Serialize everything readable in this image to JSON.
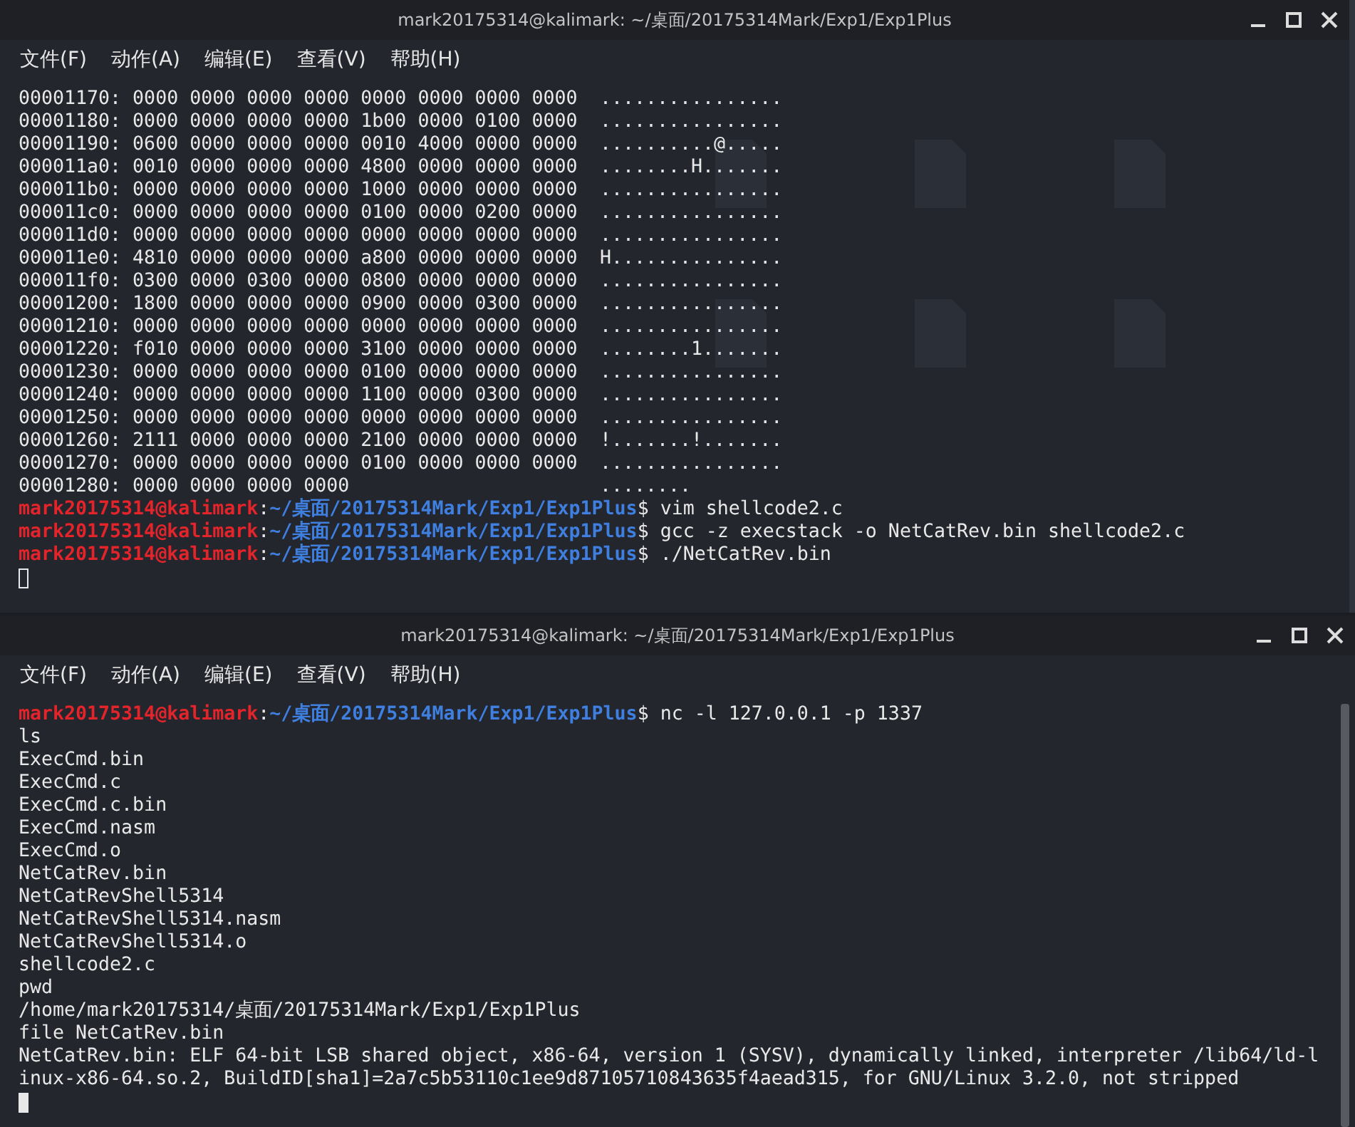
{
  "windows": [
    {
      "title": "mark20175314@kalimark: ~/桌面/20175314Mark/Exp1/Exp1Plus",
      "focused": false,
      "scrollbar": false,
      "desktop_behind": true,
      "menu": [
        "文件(F)",
        "动作(A)",
        "编辑(E)",
        "查看(V)",
        "帮助(H)"
      ],
      "lines": [
        {
          "kind": "hex",
          "text": "00001170: 0000 0000 0000 0000 0000 0000 0000 0000",
          "ascii": "................"
        },
        {
          "kind": "hex",
          "text": "00001180: 0000 0000 0000 0000 1b00 0000 0100 0000",
          "ascii": "................"
        },
        {
          "kind": "hex",
          "text": "00001190: 0600 0000 0000 0000 0010 4000 0000 0000",
          "ascii": "..........@....."
        },
        {
          "kind": "hex",
          "text": "000011a0: 0010 0000 0000 0000 4800 0000 0000 0000",
          "ascii": "........H......."
        },
        {
          "kind": "hex",
          "text": "000011b0: 0000 0000 0000 0000 1000 0000 0000 0000",
          "ascii": "................"
        },
        {
          "kind": "hex",
          "text": "000011c0: 0000 0000 0000 0000 0100 0000 0200 0000",
          "ascii": "................"
        },
        {
          "kind": "hex",
          "text": "000011d0: 0000 0000 0000 0000 0000 0000 0000 0000",
          "ascii": "................"
        },
        {
          "kind": "hex",
          "text": "000011e0: 4810 0000 0000 0000 a800 0000 0000 0000",
          "ascii": "H..............."
        },
        {
          "kind": "hex",
          "text": "000011f0: 0300 0000 0300 0000 0800 0000 0000 0000",
          "ascii": "................"
        },
        {
          "kind": "hex",
          "text": "00001200: 1800 0000 0000 0000 0900 0000 0300 0000",
          "ascii": "................"
        },
        {
          "kind": "hex",
          "text": "00001210: 0000 0000 0000 0000 0000 0000 0000 0000",
          "ascii": "................"
        },
        {
          "kind": "hex",
          "text": "00001220: f010 0000 0000 0000 3100 0000 0000 0000",
          "ascii": "........1......."
        },
        {
          "kind": "hex",
          "text": "00001230: 0000 0000 0000 0000 0100 0000 0000 0000",
          "ascii": "................"
        },
        {
          "kind": "hex",
          "text": "00001240: 0000 0000 0000 0000 1100 0000 0300 0000",
          "ascii": "................"
        },
        {
          "kind": "hex",
          "text": "00001250: 0000 0000 0000 0000 0000 0000 0000 0000",
          "ascii": "................"
        },
        {
          "kind": "hex",
          "text": "00001260: 2111 0000 0000 0000 2100 0000 0000 0000",
          "ascii": "!.......!......."
        },
        {
          "kind": "hex",
          "text": "00001270: 0000 0000 0000 0000 0100 0000 0000 0000",
          "ascii": "................"
        },
        {
          "kind": "hex",
          "text": "00001280: 0000 0000 0000 0000",
          "ascii": "........"
        },
        {
          "kind": "prompt",
          "user": "mark20175314@kalimark",
          "sep": ":",
          "path": "~/桌面/20175314Mark/Exp1/Exp1Plus",
          "symbol": "$",
          "command": "vim shellcode2.c"
        },
        {
          "kind": "prompt",
          "user": "mark20175314@kalimark",
          "sep": ":",
          "path": "~/桌面/20175314Mark/Exp1/Exp1Plus",
          "symbol": "$",
          "command": "gcc -z execstack -o NetCatRev.bin shellcode2.c"
        },
        {
          "kind": "prompt",
          "user": "mark20175314@kalimark",
          "sep": ":",
          "path": "~/桌面/20175314Mark/Exp1/Exp1Plus",
          "symbol": "$",
          "command": "./NetCatRev.bin"
        }
      ]
    },
    {
      "title": "mark20175314@kalimark: ~/桌面/20175314Mark/Exp1/Exp1Plus",
      "focused": true,
      "scrollbar": true,
      "desktop_behind": false,
      "menu": [
        "文件(F)",
        "动作(A)",
        "编辑(E)",
        "查看(V)",
        "帮助(H)"
      ],
      "lines": [
        {
          "kind": "prompt",
          "user": "mark20175314@kalimark",
          "sep": ":",
          "path": "~/桌面/20175314Mark/Exp1/Exp1Plus",
          "symbol": "$",
          "command": "nc -l 127.0.0.1 -p 1337"
        },
        {
          "kind": "output",
          "text": "ls"
        },
        {
          "kind": "output",
          "text": "ExecCmd.bin"
        },
        {
          "kind": "output",
          "text": "ExecCmd.c"
        },
        {
          "kind": "output",
          "text": "ExecCmd.c.bin"
        },
        {
          "kind": "output",
          "text": "ExecCmd.nasm"
        },
        {
          "kind": "output",
          "text": "ExecCmd.o"
        },
        {
          "kind": "output",
          "text": "NetCatRev.bin"
        },
        {
          "kind": "output",
          "text": "NetCatRevShell5314"
        },
        {
          "kind": "output",
          "text": "NetCatRevShell5314.nasm"
        },
        {
          "kind": "output",
          "text": "NetCatRevShell5314.o"
        },
        {
          "kind": "output",
          "text": "shellcode2.c"
        },
        {
          "kind": "output",
          "text": "pwd"
        },
        {
          "kind": "output",
          "text": "/home/mark20175314/桌面/20175314Mark/Exp1/Exp1Plus"
        },
        {
          "kind": "output",
          "text": "file NetCatRev.bin"
        },
        {
          "kind": "output",
          "text": "NetCatRev.bin: ELF 64-bit LSB shared object, x86-64, version 1 (SYSV), dynamically linked, interpreter /lib64/ld-l"
        },
        {
          "kind": "output",
          "text": "inux-x86-64.so.2, BuildID[sha1]=2a7c5b53110c1ee9d87105710843635f4aead315, for GNU/Linux 3.2.0, not stripped"
        }
      ]
    }
  ]
}
